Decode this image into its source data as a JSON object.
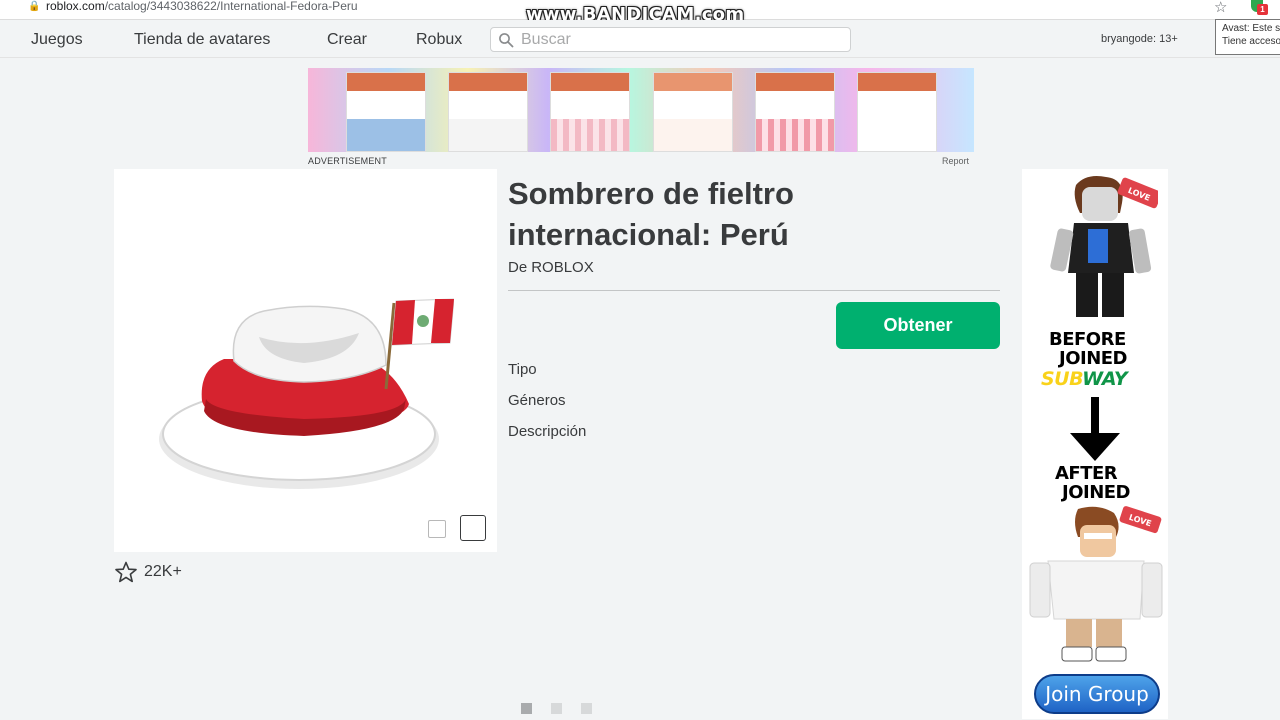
{
  "browser": {
    "url_host": "roblox.com",
    "url_path": "/catalog/3443038622/International-Fedora-Peru",
    "avast_badge": "1",
    "avast_tooltip_line1": "Avast: Este s",
    "avast_tooltip_line2": "Tiene acceso"
  },
  "watermark": "www.BANDICAM.com",
  "nav": {
    "items": [
      "Juegos",
      "Tienda de avatares",
      "Crear",
      "Robux"
    ],
    "search_placeholder": "Buscar",
    "user": "bryangode: 13+"
  },
  "ad_top": {
    "label": "ADVERTISEMENT",
    "report": "Report"
  },
  "item": {
    "title": "Sombrero de fieltro internacional: Perú",
    "creator_prefix": "De",
    "creator_name": "ROBLOX",
    "buy_label": "Obtener",
    "favorites": "22K+",
    "details": [
      "Tipo",
      "Géneros",
      "Descripción"
    ]
  },
  "side_ad": {
    "before_line1": "BEFORE",
    "before_line2": "JOINED",
    "brand_part1": "SUB",
    "brand_part2": "WAY",
    "after_line1": "AFTER",
    "after_line2": "JOINED",
    "love_tag": "LOVE",
    "join_label": "Join Group"
  },
  "colors": {
    "buy_green": "#00b06f",
    "page_bg": "#f2f4f5",
    "text": "#393b3d",
    "peru_red": "#d6232f"
  },
  "pagination": {
    "active_index": 0,
    "count": 3
  }
}
